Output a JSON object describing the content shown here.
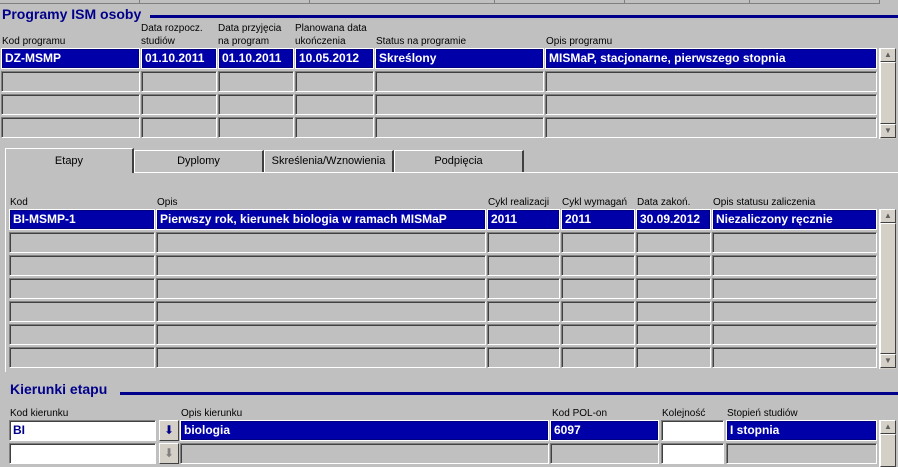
{
  "programs": {
    "title": "Programy ISM osoby",
    "headers": {
      "kod": "Kod programu",
      "data_rozp": [
        "Data rozpocz.",
        "studiów"
      ],
      "data_przyj": [
        "Data przyjęcia",
        "na program"
      ],
      "planowana": [
        "Planowana data",
        "ukończenia"
      ],
      "status": "Status na programie",
      "opis": "Opis programu"
    },
    "rows": [
      {
        "kod": "DZ-MSMP",
        "data_rozp": "01.10.2011",
        "data_przyj": "01.10.2011",
        "planowana": "10.05.2012",
        "status": "Skreślony",
        "opis": "MISMaP, stacjonarne, pierwszego stopnia"
      },
      {
        "kod": "",
        "data_rozp": "",
        "data_przyj": "",
        "planowana": "",
        "status": "",
        "opis": ""
      },
      {
        "kod": "",
        "data_rozp": "",
        "data_przyj": "",
        "planowana": "",
        "status": "",
        "opis": ""
      },
      {
        "kod": "",
        "data_rozp": "",
        "data_przyj": "",
        "planowana": "",
        "status": "",
        "opis": ""
      }
    ]
  },
  "tabs": [
    {
      "label": "Etapy"
    },
    {
      "label": "Dyplomy"
    },
    {
      "label": "Skreślenia/Wznowienia"
    },
    {
      "label": "Podpięcia"
    }
  ],
  "etapy": {
    "headers": {
      "kod": "Kod",
      "opis": "Opis",
      "cykl_real": "Cykl realizacji",
      "cykl_wym": "Cykl wymagań",
      "data_zak": "Data zakoń.",
      "opis_status": "Opis statusu zaliczenia"
    },
    "rows": [
      {
        "kod": "BI-MSMP-1",
        "opis": "Pierwszy rok, kierunek biologia w ramach MISMaP",
        "cykl_real": "2011",
        "cykl_wym": "2011",
        "data_zak": "30.09.2012",
        "opis_status": "Niezaliczony ręcznie"
      },
      {
        "kod": "",
        "opis": "",
        "cykl_real": "",
        "cykl_wym": "",
        "data_zak": "",
        "opis_status": ""
      },
      {
        "kod": "",
        "opis": "",
        "cykl_real": "",
        "cykl_wym": "",
        "data_zak": "",
        "opis_status": ""
      },
      {
        "kod": "",
        "opis": "",
        "cykl_real": "",
        "cykl_wym": "",
        "data_zak": "",
        "opis_status": ""
      },
      {
        "kod": "",
        "opis": "",
        "cykl_real": "",
        "cykl_wym": "",
        "data_zak": "",
        "opis_status": ""
      },
      {
        "kod": "",
        "opis": "",
        "cykl_real": "",
        "cykl_wym": "",
        "data_zak": "",
        "opis_status": ""
      },
      {
        "kod": "",
        "opis": "",
        "cykl_real": "",
        "cykl_wym": "",
        "data_zak": "",
        "opis_status": ""
      }
    ]
  },
  "kierunki": {
    "title": "Kierunki etapu",
    "headers": {
      "kod": "Kod kierunku",
      "opis": "Opis kierunku",
      "pol_on": "Kod POL-on",
      "kolejnosc": "Kolejność",
      "stopien": "Stopień studiów"
    },
    "rows": [
      {
        "kod": "BI",
        "opis": "biologia",
        "pol_on": "6097",
        "kolejnosc": "",
        "stopien": "I stopnia"
      },
      {
        "kod": "",
        "opis": "",
        "pol_on": "",
        "kolejnosc": "",
        "stopien": ""
      }
    ]
  },
  "icons": {
    "lov": "arrow-down-icon",
    "scroll_up": "triangle-up-icon",
    "scroll_down": "triangle-down-icon"
  },
  "colors": {
    "background": "#c0c0c0",
    "selected": "#0000a8",
    "title": "#00008b"
  }
}
